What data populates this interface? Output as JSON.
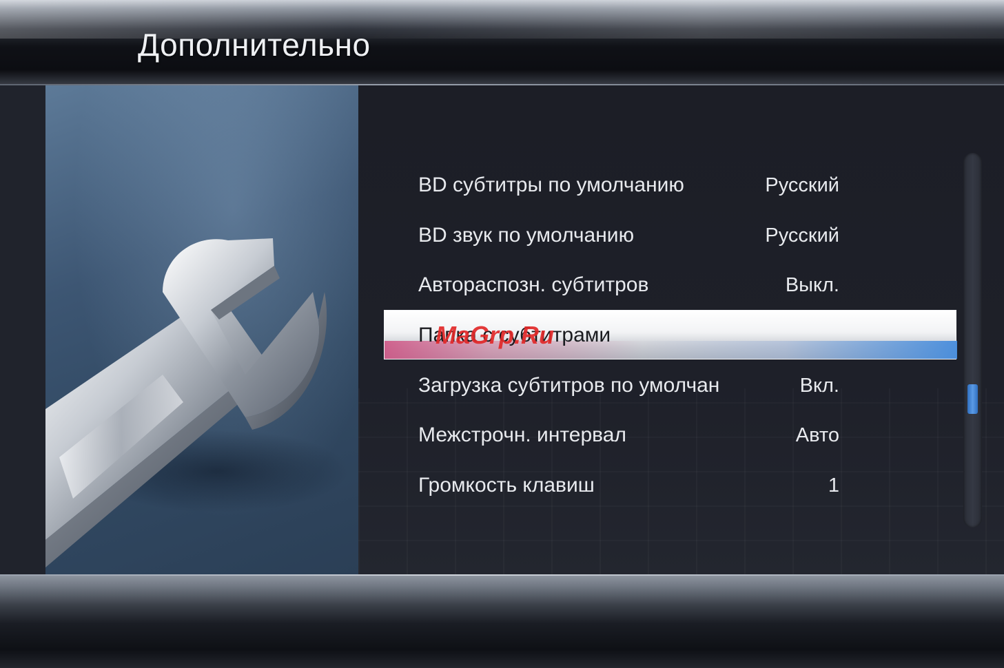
{
  "header": {
    "title": "Дополнительно"
  },
  "menu": {
    "items": [
      {
        "label": "BD субтитры по умолчанию",
        "value": "Русский"
      },
      {
        "label": "BD звук по умолчанию",
        "value": "Русский"
      },
      {
        "label": "Автораспозн. субтитров",
        "value": "Выкл."
      },
      {
        "label": "Папка с субтитрами",
        "value": "",
        "selected": true
      },
      {
        "label": "Загрузка субтитров по умолчан",
        "value": "Вкл."
      },
      {
        "label": "Межстрочн. интервал",
        "value": "Авто"
      },
      {
        "label": "Громкость клавиш",
        "value": "1"
      }
    ]
  },
  "watermark": {
    "text": "MaGrp.Ru"
  },
  "icons": {
    "illustration": "wrench-icon"
  },
  "colors": {
    "selection_accent_left": "#ce4e80",
    "selection_accent_right": "#468cdc",
    "scroll_thumb": "#5b9be6"
  }
}
